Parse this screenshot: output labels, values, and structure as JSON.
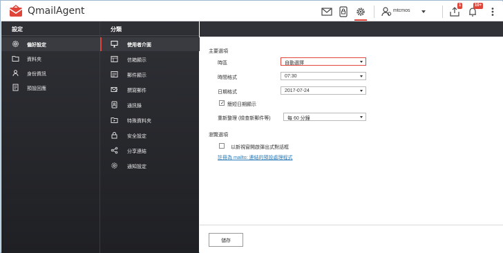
{
  "app": {
    "title": "QmailAgent"
  },
  "topbar": {
    "icons": [
      "mail-icon",
      "lock-icon",
      "settings-gear-icon",
      "user-icon",
      "tasks-icon",
      "notification-bell-icon",
      "more-menu-icon"
    ],
    "user_name": "mtcmos",
    "tasks_badge": "1",
    "notifications_badge": "10+",
    "accent_color": "#e0453a"
  },
  "settings_panel": {
    "header": "設定",
    "items": [
      {
        "label": "偏好設定",
        "icon": "gear-icon",
        "active": true
      },
      {
        "label": "資料夾",
        "icon": "folder-icon",
        "active": false
      },
      {
        "label": "身份資訊",
        "icon": "identity-icon",
        "active": false
      },
      {
        "label": "預設回應",
        "icon": "document-icon",
        "active": false
      }
    ]
  },
  "category_panel": {
    "header": "分類",
    "items": [
      {
        "label": "使用者介面",
        "icon": "monitor-icon",
        "active": true
      },
      {
        "label": "信箱顯示",
        "icon": "mailbox-view-icon",
        "active": false
      },
      {
        "label": "郵件顯示",
        "icon": "message-view-icon",
        "active": false
      },
      {
        "label": "撰寫郵件",
        "icon": "compose-icon",
        "active": false
      },
      {
        "label": "通訊錄",
        "icon": "address-book-icon",
        "active": false
      },
      {
        "label": "特殊資料夾",
        "icon": "special-folder-icon",
        "active": false
      },
      {
        "label": "安全設定",
        "icon": "lock-icon",
        "active": false
      },
      {
        "label": "分享連結",
        "icon": "share-icon",
        "active": false
      },
      {
        "label": "通知設定",
        "icon": "notification-gear-icon",
        "active": false
      }
    ]
  },
  "main_options": {
    "title": "主要選項",
    "timezone": {
      "label": "時區",
      "value": "自動選擇"
    },
    "time_format": {
      "label": "時間格式",
      "value": "07:30"
    },
    "date_format": {
      "label": "日期格式",
      "value": "2017-07-24"
    },
    "short_date": {
      "label": "簡短日期顯示",
      "checked": true
    },
    "refresh": {
      "label": "重新整理 (檢查新郵件等)",
      "value": "每 60 分鐘"
    }
  },
  "browser_options": {
    "title": "瀏覽選項",
    "new_window": {
      "label": "以新視窗開啟彈出式對話框",
      "checked": false
    },
    "mailto_link": "註冊為 mailto: 連結的預設處理程式"
  },
  "footer": {
    "save_label": "儲存"
  }
}
